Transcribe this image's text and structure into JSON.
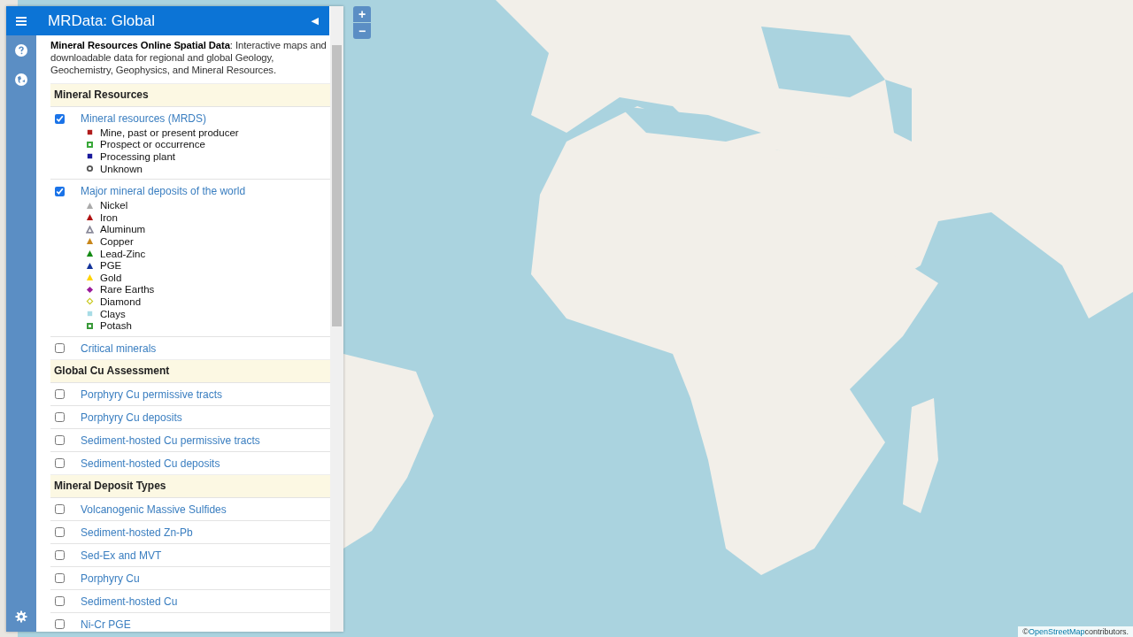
{
  "map": {
    "kind": "picture",
    "zoom_controls": [
      "+",
      "−"
    ],
    "attribution": {
      "mark": "©",
      "link": "OpenStreetMap",
      "text": "contributors."
    }
  },
  "sidebar": {
    "title": "MRData: Global",
    "collapse_glyph": "◀",
    "intro": "**Mineral Resources Online Spatial Data**: Interactive maps and downloadable data for regional and global Geology, Geochemistry, Geophysics, and Mineral Resources.",
    "sections": [
      {
        "heading": "Mineral Resources",
        "layers": [
          {
            "label": "Mineral resources (MRDS)",
            "checked": true,
            "legend": [
              {
                "label": "Mine, past or present producer",
                "kind": "square",
                "color": "#b01c1c"
              },
              {
                "label": "Prospect or occurrence",
                "kind": "square-outline",
                "color": "#3aa83a"
              },
              {
                "label": "Processing plant",
                "kind": "square",
                "color": "#1a1a9c"
              },
              {
                "label": "Unknown",
                "kind": "circle-outline",
                "color": "#555555"
              }
            ]
          },
          {
            "label": "Major mineral deposits of the world",
            "checked": true,
            "legend": [
              {
                "label": "Nickel",
                "kind": "triangle",
                "color": "#aaaaaa"
              },
              {
                "label": "Iron",
                "kind": "triangle",
                "color": "#b01010"
              },
              {
                "label": "Aluminum",
                "kind": "triangle-outline",
                "color": "#8a8a9a"
              },
              {
                "label": "Copper",
                "kind": "triangle",
                "color": "#c8861a"
              },
              {
                "label": "Lead-Zinc",
                "kind": "triangle",
                "color": "#138a13"
              },
              {
                "label": "PGE",
                "kind": "triangle",
                "color": "#12329a"
              },
              {
                "label": "Gold",
                "kind": "triangle",
                "color": "#ffd200"
              },
              {
                "label": "Rare Earths",
                "kind": "diamond",
                "color": "#9a1a9a"
              },
              {
                "label": "Diamond",
                "kind": "diamond-outline",
                "color": "#c8c81a"
              },
              {
                "label": "Clays",
                "kind": "square",
                "color": "#a8dce6"
              },
              {
                "label": "Potash",
                "kind": "square-outline",
                "color": "#3a9a3a"
              }
            ]
          },
          {
            "label": "Critical minerals",
            "checked": false
          }
        ]
      },
      {
        "heading": "Global Cu Assessment",
        "layers": [
          {
            "label": "Porphyry Cu permissive tracts",
            "checked": false
          },
          {
            "label": "Porphyry Cu deposits",
            "checked": false
          },
          {
            "label": "Sediment-hosted Cu permissive tracts",
            "checked": false
          },
          {
            "label": "Sediment-hosted Cu deposits",
            "checked": false
          }
        ]
      },
      {
        "heading": "Mineral Deposit Types",
        "layers": [
          {
            "label": "Volcanogenic Massive Sulfides",
            "checked": false
          },
          {
            "label": "Sediment-hosted Zn-Pb",
            "checked": false
          },
          {
            "label": "Sed-Ex and MVT",
            "checked": false
          },
          {
            "label": "Porphyry Cu",
            "checked": false
          },
          {
            "label": "Sediment-hosted Cu",
            "checked": false
          },
          {
            "label": "Ni-Cr PGE",
            "checked": false
          }
        ]
      }
    ]
  }
}
